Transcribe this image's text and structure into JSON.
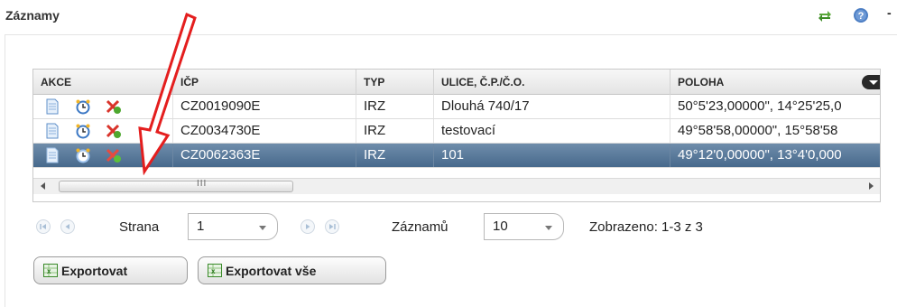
{
  "header": {
    "title": "Záznamy",
    "trailing": "-"
  },
  "grid": {
    "columns": [
      "AKCE",
      "IČP",
      "TYP",
      "ULICE, Č.P./Č.O.",
      "POLOHA"
    ],
    "rows": [
      {
        "icp": "CZ0019090E",
        "typ": "IRZ",
        "ulice": "Dlouhá 740/17",
        "poloha": "50°5'23,00000\", 14°25'25,0",
        "selected": false
      },
      {
        "icp": "CZ0034730E",
        "typ": "IRZ",
        "ulice": "testovací",
        "poloha": "49°58'58,00000\", 15°58'58",
        "selected": false
      },
      {
        "icp": "CZ0062363E",
        "typ": "IRZ",
        "ulice": "101",
        "poloha": "49°12'0,00000\", 13°4'0,000",
        "selected": true
      }
    ],
    "scrollbar_grip": "III"
  },
  "pager": {
    "page_label": "Strana",
    "page_value": "1",
    "records_label": "Záznamů",
    "records_value": "10",
    "summary": "Zobrazeno: 1-3 z 3"
  },
  "buttons": {
    "export": "Exportovat",
    "export_all": "Exportovat vše"
  },
  "colors": {
    "selected_row": "#4f7195",
    "annotation_arrow": "#e41e1e",
    "cancel_icon": "#d9342b",
    "green_icon": "#4ea82f"
  },
  "icons": [
    "refresh-icon",
    "help-icon",
    "document-icon",
    "alarm-clock-icon",
    "cancel-icon",
    "excel-icon"
  ]
}
